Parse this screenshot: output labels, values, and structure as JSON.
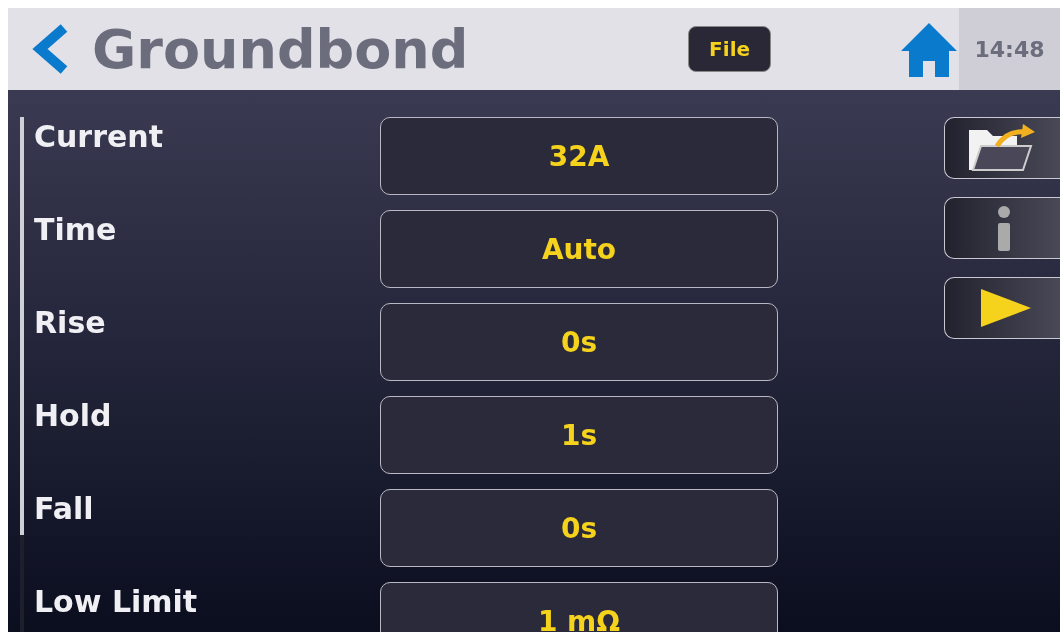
{
  "header": {
    "title": "Groundbond",
    "file_button": "File",
    "time": "14:48"
  },
  "parameters": [
    {
      "label": "Current",
      "value": "32A"
    },
    {
      "label": "Time",
      "value": "Auto"
    },
    {
      "label": "Rise",
      "value": "0s"
    },
    {
      "label": "Hold",
      "value": "1s"
    },
    {
      "label": "Fall",
      "value": "0s"
    },
    {
      "label": "Low Limit",
      "value": "1 mΩ"
    }
  ]
}
